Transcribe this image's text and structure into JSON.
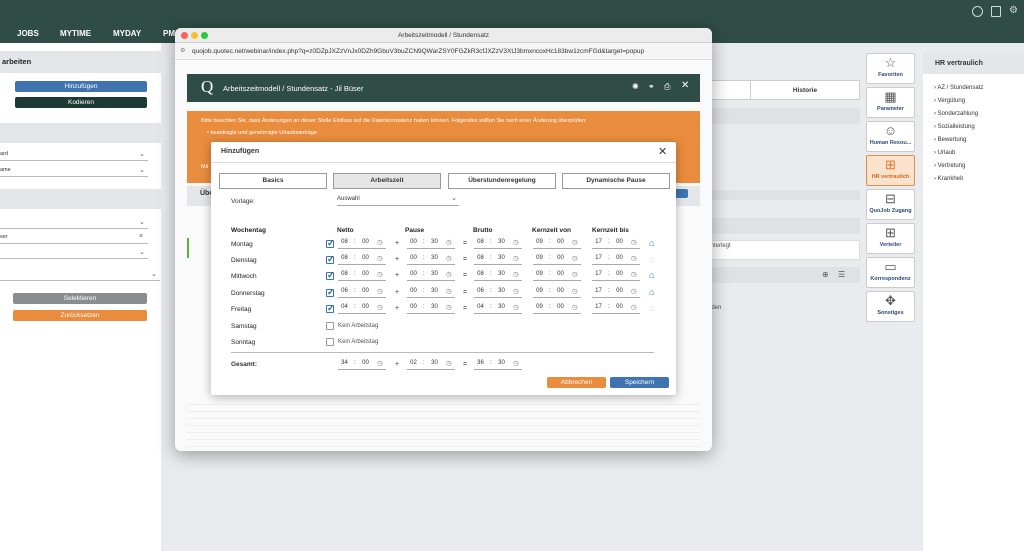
{
  "topnav": {
    "items": [
      "JOBS",
      "MYTIME",
      "MYDAY",
      "PM"
    ]
  },
  "left": {
    "heading": "arbeiten",
    "add": "Hinzufügen",
    "code": "Kodieren",
    "field1": "ard",
    "field2": "ame",
    "field3": "ser",
    "select": "Selektieren",
    "reset": "Zurücksetzen"
  },
  "background": {
    "historie": "Historie",
    "hinterlegt": "hinterlegt",
    "nden": "nden"
  },
  "right_sidebar": [
    {
      "label": "Favoriten",
      "icon": "☆"
    },
    {
      "label": "Parameter",
      "icon": "▦"
    },
    {
      "label": "Human Resou...",
      "icon": "☺"
    },
    {
      "label": "HR vertraulich",
      "icon": "⊞"
    },
    {
      "label": "QuoJob Zugang",
      "icon": "⊟"
    },
    {
      "label": "Verteiler",
      "icon": "⊞"
    },
    {
      "label": "Korrespondenz",
      "icon": "▭"
    },
    {
      "label": "Sonstiges",
      "icon": "✥"
    }
  ],
  "hr_panel": {
    "title": "HR vertraulich",
    "items": [
      "AZ / Stundensatz",
      "Vergütung",
      "Sonderzahlung",
      "Sozialleistung",
      "Bewertung",
      "Urlaub",
      "Vertretung",
      "Krankheit"
    ]
  },
  "window": {
    "title": "Arbeitszeitmodell / Stundensatz",
    "url": "quojob.quotec.net/webinar/index.php?q=z0DZpJXZzVnJx0DZh9GbuV3buZCN9QWarZSY0FGZkR3cfJXZzV3XtJ3bmxncoxHc183bw1zcmFGd&target=popup",
    "header_logo": "Q",
    "header_title": "Arbeitszeitmodell / Stundensatz - Jil Büser",
    "notice_text": "Bitte beachten Sie, dass Änderungen an dieser Stelle Einfluss auf die Datenkonsistenz haben können. Folgendes sollten Sie nach einer Änderung überprüfen:",
    "notice_bullet1": "beantragte und genehmigte Urlaubsanträge",
    "notice_mit": "Mit",
    "under_label": "Übe"
  },
  "dialog": {
    "title": "Hinzufügen",
    "tabs": [
      "Basics",
      "Arbeitszeit",
      "Überstundenregelung",
      "Dynamische Pause"
    ],
    "active_tab": "Arbeitszeit",
    "vorlage_label": "Vorlage:",
    "vorlage_value": "Auswahl",
    "headers": {
      "day": "Wochentag",
      "netto": "Netto",
      "pause": "Pause",
      "brutto": "Brutto",
      "kvon": "Kernzeit von",
      "kbis": "Kernzeit bis"
    },
    "rows": [
      {
        "day": "Montag",
        "checked": true,
        "netto": [
          "08",
          "00"
        ],
        "pause": [
          "00",
          "30"
        ],
        "brutto": [
          "08",
          "30"
        ],
        "kvon": [
          "09",
          "00"
        ],
        "kbis": [
          "17",
          "00"
        ],
        "home": true
      },
      {
        "day": "Dienstag",
        "checked": true,
        "netto": [
          "08",
          "00"
        ],
        "pause": [
          "00",
          "30"
        ],
        "brutto": [
          "08",
          "30"
        ],
        "kvon": [
          "09",
          "00"
        ],
        "kbis": [
          "17",
          "00"
        ],
        "home": false
      },
      {
        "day": "Mittwoch",
        "checked": true,
        "netto": [
          "08",
          "00"
        ],
        "pause": [
          "00",
          "30"
        ],
        "brutto": [
          "08",
          "30"
        ],
        "kvon": [
          "09",
          "00"
        ],
        "kbis": [
          "17",
          "00"
        ],
        "home": true
      },
      {
        "day": "Donnerstag",
        "checked": true,
        "netto": [
          "06",
          "00"
        ],
        "pause": [
          "00",
          "30"
        ],
        "brutto": [
          "06",
          "30"
        ],
        "kvon": [
          "09",
          "00"
        ],
        "kbis": [
          "17",
          "00"
        ],
        "home": true
      },
      {
        "day": "Freitag",
        "checked": true,
        "netto": [
          "04",
          "00"
        ],
        "pause": [
          "00",
          "30"
        ],
        "brutto": [
          "04",
          "30"
        ],
        "kvon": [
          "09",
          "00"
        ],
        "kbis": [
          "17",
          "00"
        ],
        "home": false
      },
      {
        "day": "Samstag",
        "checked": false,
        "kein": "Kein Arbeitstag"
      },
      {
        "day": "Sonntag",
        "checked": false,
        "kein": "Kein Arbeitstag"
      }
    ],
    "total_label": "Gesamt:",
    "total": {
      "netto": [
        "34",
        "00"
      ],
      "pause": [
        "02",
        "30"
      ],
      "brutto": [
        "36",
        "30"
      ]
    },
    "cancel": "Abbrechen",
    "save": "Speichern"
  }
}
